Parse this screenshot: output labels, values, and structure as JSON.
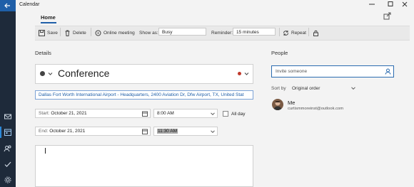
{
  "app": {
    "title": "Calendar"
  },
  "tabs": {
    "home": "Home"
  },
  "toolbar": {
    "save": "Save",
    "delete": "Delete",
    "online_meeting": "Online meeting",
    "show_as_label": "Show as:",
    "show_as_value": "Busy",
    "reminder_label": "Reminder:",
    "reminder_value": "15 minutes",
    "repeat": "Repeat"
  },
  "details": {
    "heading": "Details",
    "event_title": "Conference",
    "location": "Dallas Fort Worth International Airport - Headquarters, 2400 Aviation Dr, Dfw Airport, TX, United Stat",
    "start_label": "Start:",
    "start_date": "October 21, 2021",
    "start_time": "8:00 AM",
    "all_day": "All day",
    "end_label": "End:",
    "end_date": "October 21, 2021",
    "end_time": "11:30 AM"
  },
  "people": {
    "heading": "People",
    "invite_placeholder": "Invite someone",
    "sort_label": "Sort by",
    "sort_value": "Original order",
    "attendee_name": "Me",
    "attendee_email": "curtismmoreinst@outlook.com"
  },
  "colors": {
    "accent": "#1f5fa8",
    "rail": "#1e2a3a",
    "category_dot": "#c0392b",
    "time_highlight": "#a9a9a9"
  }
}
